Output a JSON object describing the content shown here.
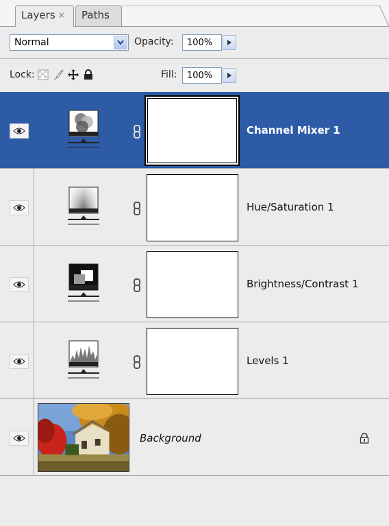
{
  "tabs": [
    {
      "label": "Layers",
      "close": "×",
      "active": true
    },
    {
      "label": "Paths",
      "active": false
    }
  ],
  "blend_mode": {
    "value": "Normal",
    "icon": "chevron-down-icon"
  },
  "opacity": {
    "label": "Opacity:",
    "value": "100%"
  },
  "lock": {
    "label": "Lock:",
    "icons": [
      "lock-transparent-pixels-icon",
      "lock-image-pixels-icon",
      "lock-position-icon",
      "lock-all-icon"
    ]
  },
  "fill": {
    "label": "Fill:",
    "value": "100%"
  },
  "layers": [
    {
      "name": "Channel Mixer 1",
      "type": "adjustment",
      "icon": "channel-mixer-icon",
      "selected": true,
      "visible": true
    },
    {
      "name": "Hue/Saturation 1",
      "type": "adjustment",
      "icon": "hue-saturation-icon",
      "selected": false,
      "visible": true
    },
    {
      "name": "Brightness/Contrast 1",
      "type": "adjustment",
      "icon": "brightness-contrast-icon",
      "selected": false,
      "visible": true
    },
    {
      "name": "Levels 1",
      "type": "adjustment",
      "icon": "levels-icon",
      "selected": false,
      "visible": true
    },
    {
      "name": "Background",
      "type": "image",
      "locked": true,
      "visible": true
    }
  ],
  "colors": {
    "selection": "#2d5ba6",
    "panel": "#ececec"
  }
}
